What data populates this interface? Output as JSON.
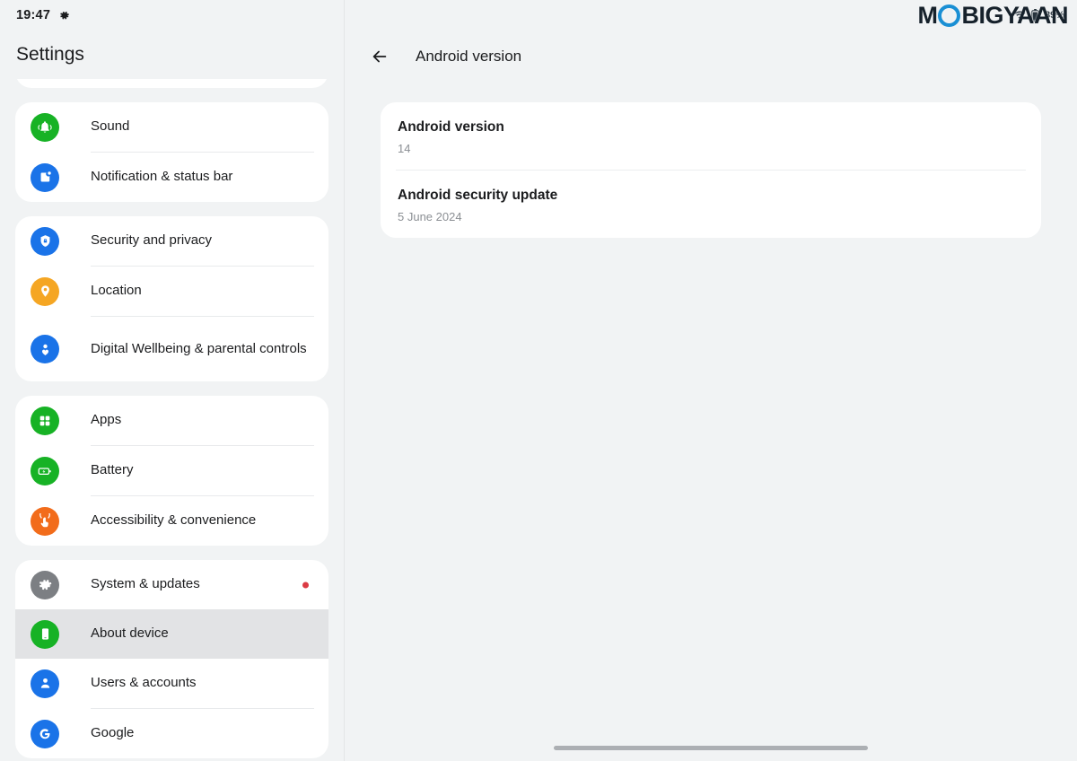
{
  "statusbar": {
    "time": "19:47",
    "settings_icon": "gear-icon",
    "wifi_icon": "wifi-icon",
    "battery_icon": "battery-icon",
    "battery_percent": "89%"
  },
  "watermark": {
    "text_before": "M",
    "text_after": "BIGYAAN",
    "accent_color": "#1a8fd4"
  },
  "sidebar": {
    "title": "Settings",
    "groups": [
      {
        "clipped": true,
        "items": [
          {
            "label": "",
            "icon": "display-icon",
            "icon_color": "#f0ab1d"
          }
        ]
      },
      {
        "items": [
          {
            "label": "Sound",
            "icon": "bell-icon",
            "icon_color": "#17b225"
          },
          {
            "label": "Notification & status bar",
            "icon": "notification-card-icon",
            "icon_color": "#1a73e8"
          }
        ]
      },
      {
        "items": [
          {
            "label": "Security and privacy",
            "icon": "shield-lock-icon",
            "icon_color": "#1a73e8"
          },
          {
            "label": "Location",
            "icon": "location-pin-icon",
            "icon_color": "#f5a623"
          },
          {
            "label": "Digital Wellbeing & parental controls",
            "icon": "person-heart-icon",
            "icon_color": "#1a73e8"
          }
        ]
      },
      {
        "items": [
          {
            "label": "Apps",
            "icon": "grid-apps-icon",
            "icon_color": "#17b225"
          },
          {
            "label": "Battery",
            "icon": "battery-bolt-icon",
            "icon_color": "#17b225"
          },
          {
            "label": "Accessibility & convenience",
            "icon": "hand-touch-icon",
            "icon_color": "#f26c1b"
          }
        ]
      },
      {
        "items": [
          {
            "label": "System & updates",
            "icon": "gear-icon",
            "icon_color": "#7c7f83",
            "badge": "dot",
            "badge_color": "#db3b44"
          },
          {
            "label": "About device",
            "icon": "phone-device-icon",
            "icon_color": "#17b225",
            "selected": true
          },
          {
            "label": "Users & accounts",
            "icon": "person-icon",
            "icon_color": "#1a73e8"
          },
          {
            "label": "Google",
            "icon": "google-g-icon",
            "icon_color": "#1a73e8"
          }
        ]
      }
    ]
  },
  "content": {
    "back_icon": "arrow-left-icon",
    "title": "Android version",
    "info_rows": [
      {
        "key": "Android version",
        "value": "14"
      },
      {
        "key": "Android security update",
        "value": "5 June 2024"
      }
    ]
  },
  "navbar": {
    "handle": "home-gesture-pill"
  }
}
